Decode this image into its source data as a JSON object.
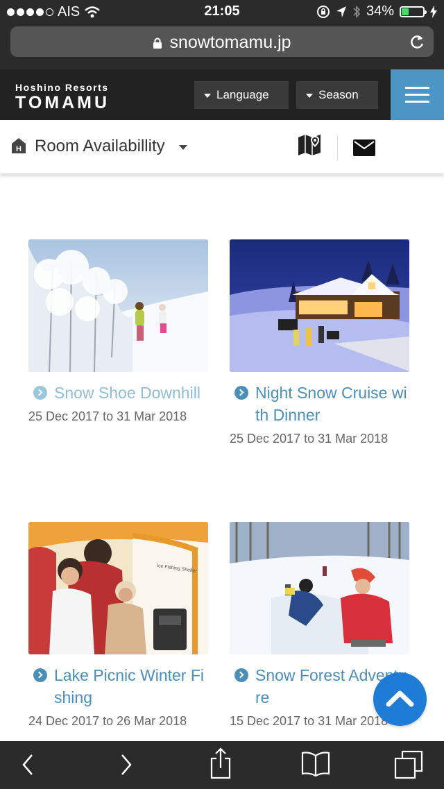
{
  "status_bar": {
    "carrier": "AIS",
    "time": "21:05",
    "battery": "34%",
    "battery_level": 0.34,
    "battery_color": "#4cd964"
  },
  "browser": {
    "url": "snowtomamu.jp"
  },
  "site_header": {
    "logo_top": "Hoshino Resorts",
    "logo_main": "TOMAMU",
    "language_label": "Language",
    "season_label": "Season",
    "menu_color": "#4b96c4"
  },
  "sub_nav": {
    "title": "Room Availabillity",
    "icons": [
      "house-icon",
      "map-icon",
      "mail-icon"
    ]
  },
  "activities": [
    {
      "title": "Snow Shoe Downhill",
      "dates": "25 Dec 2017 to 31 Mar 2018"
    },
    {
      "title": "Night Snow Cruise wi th Dinner",
      "dates": "25 Dec 2017 to 31 Mar 2018"
    },
    {
      "title": "Lake Picnic Winter Fi shing",
      "dates": "24 Dec 2017 to 26 Mar 2018"
    },
    {
      "title": "Snow Forest Adventu re",
      "dates": "15 Dec 2017 to 31 Mar 2018"
    }
  ],
  "colors": {
    "link": "#4b8fb8",
    "fab": "#1e7bd6"
  }
}
